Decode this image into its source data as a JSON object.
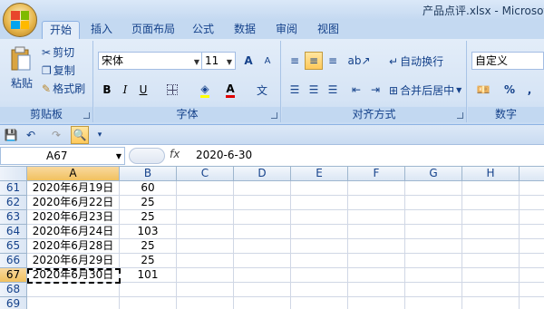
{
  "window": {
    "title": "产品点评.xlsx - Microsoft E"
  },
  "tabs": [
    {
      "label": "开始",
      "active": true
    },
    {
      "label": "插入",
      "active": false
    },
    {
      "label": "页面布局",
      "active": false
    },
    {
      "label": "公式",
      "active": false
    },
    {
      "label": "数据",
      "active": false
    },
    {
      "label": "审阅",
      "active": false
    },
    {
      "label": "视图",
      "active": false
    }
  ],
  "clipboard": {
    "paste": "粘贴",
    "cut": "剪切",
    "copy": "复制",
    "format_painter": "格式刷",
    "label": "剪贴板"
  },
  "font": {
    "name": "宋体",
    "size": "11",
    "bold": "B",
    "italic": "I",
    "underline": "U",
    "grow": "A",
    "shrink": "A",
    "wen": "文",
    "label": "字体"
  },
  "alignment": {
    "wrap": "自动换行",
    "merge": "合并后居中",
    "label": "对齐方式"
  },
  "number": {
    "format": "自定义",
    "percent": "%",
    "comma": ",",
    "label": "数字"
  },
  "formula_bar": {
    "name_box": "A67",
    "fx": "fx",
    "value": "2020-6-30"
  },
  "columns": [
    "A",
    "B",
    "C",
    "D",
    "E",
    "F",
    "G",
    "H"
  ],
  "rows": [
    {
      "num": "61",
      "a": "2020年6月19日",
      "b": "60"
    },
    {
      "num": "62",
      "a": "2020年6月22日",
      "b": "25"
    },
    {
      "num": "63",
      "a": "2020年6月23日",
      "b": "25"
    },
    {
      "num": "64",
      "a": "2020年6月24日",
      "b": "103"
    },
    {
      "num": "65",
      "a": "2020年6月28日",
      "b": "25"
    },
    {
      "num": "66",
      "a": "2020年6月29日",
      "b": "25"
    },
    {
      "num": "67",
      "a": "2020年6月30日",
      "b": "101"
    },
    {
      "num": "68",
      "a": "",
      "b": ""
    },
    {
      "num": "69",
      "a": "",
      "b": ""
    }
  ],
  "colors": {
    "accent": "#15428b",
    "ribbon": "#d6e4f5",
    "selection": "#f1c15f"
  }
}
